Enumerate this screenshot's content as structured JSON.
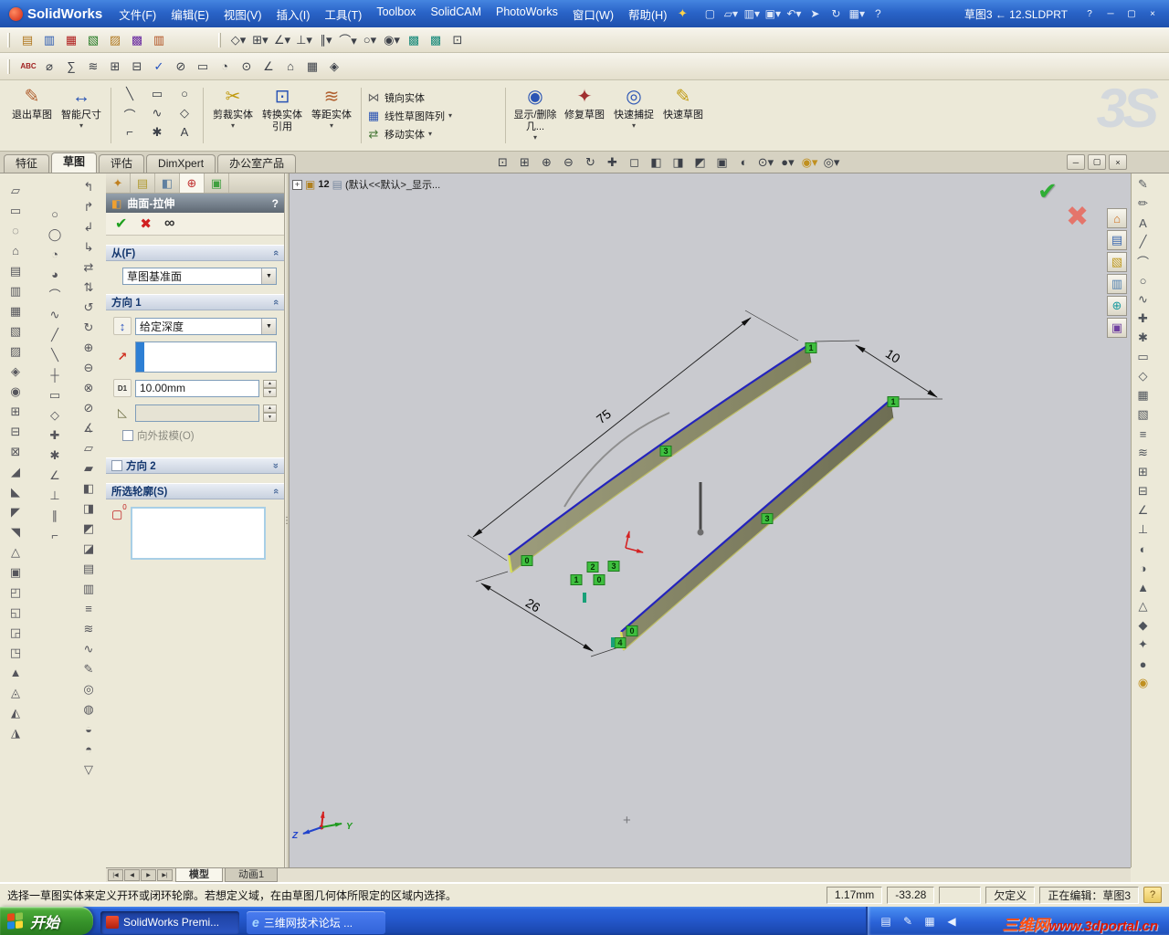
{
  "ui": {
    "chevron": "«",
    "combo_arrow": "▼",
    "spin_up": "▲",
    "spin_down": "▼",
    "drop": "▾",
    "expand": "+",
    "help": "?",
    "minimize": "─",
    "restore": "▢",
    "close": "×",
    "splitter": "⋮",
    "plus": "+"
  },
  "titlebar": {
    "app_name": "SolidWorks",
    "doc_title": "草图3 ← 12.SLDPRT",
    "assistant_icon": "✦",
    "menu_items": [
      "文件(F)",
      "编辑(E)",
      "视图(V)",
      "插入(I)",
      "工具(T)",
      "Toolbox",
      "SolidCAM",
      "PhotoWorks",
      "窗口(W)",
      "帮助(H)"
    ],
    "std_icons": [
      {
        "name": "new-doc-icon",
        "g": "▢"
      },
      {
        "name": "open-doc-icon",
        "g": "▱▾"
      },
      {
        "name": "save-icon",
        "g": "▥▾"
      },
      {
        "name": "print-icon",
        "g": "▣▾"
      },
      {
        "name": "undo-icon",
        "g": "↶▾"
      },
      {
        "name": "select-arrow-icon",
        "g": "➤"
      },
      {
        "name": "rebuild-icon",
        "g": "↻"
      },
      {
        "name": "options-icon",
        "g": "▦▾"
      },
      {
        "name": "help-icon",
        "g": "?"
      }
    ]
  },
  "toolbar_row1": {
    "left_icons": [
      {
        "name": "layer-icon",
        "g": "▤",
        "c": "#b07820"
      },
      {
        "name": "layer-props-icon",
        "g": "▥",
        "c": "#2858b0"
      },
      {
        "name": "color-swatch-icon",
        "g": "▦",
        "c": "#b02020"
      },
      {
        "name": "line-format-icon",
        "g": "▧",
        "c": "#207820"
      },
      {
        "name": "hatch-icon",
        "g": "▨",
        "c": "#b07820"
      },
      {
        "name": "grid-icon",
        "g": "▩",
        "c": "#6828a0"
      },
      {
        "name": "units-icon",
        "g": "▥",
        "c": "#b05020"
      }
    ],
    "snap_icons": [
      "◇▾",
      "⊞▾",
      "∠▾",
      "⊥▾",
      "∥▾",
      "⌒▾",
      "○▾",
      "◉▾",
      {
        "name": "solid-snap-icon",
        "g": "▩",
        "c": "#188a7a"
      },
      {
        "name": "solid-snap2-icon",
        "g": "▩",
        "c": "#188a7a"
      },
      "⊡"
    ]
  },
  "toolbar_row2": {
    "abc_label": "ABC",
    "icons": [
      "⌀",
      "∑",
      "≋",
      "⊞",
      "⊟",
      {
        "name": "check-sketch-icon",
        "g": "✓",
        "c": "#2050c0"
      },
      "⊘",
      "▭",
      "◔",
      "⊙",
      "∠",
      "⌂",
      "▦",
      "◈"
    ]
  },
  "cmd": {
    "exit_sketch": {
      "label": "退出草图",
      "g": "✎"
    },
    "smart_dim": {
      "label": "智能尺寸",
      "g": "↔"
    },
    "entity_icons": [
      "╲",
      "▭",
      "○",
      "⌒",
      "∿",
      "◇",
      "⌐",
      "✱",
      "A"
    ],
    "trim": {
      "label": "剪裁实体",
      "g": "✂"
    },
    "convert": {
      "label": "转换实体引用",
      "g": "⊡"
    },
    "offset": {
      "label": "等距实体",
      "g": "≋"
    },
    "mirror": {
      "label": "镜向实体",
      "g": "⋈"
    },
    "pattern": {
      "label": "线性草图阵列",
      "g": "▦"
    },
    "move": {
      "label": "移动实体",
      "g": "⇄"
    },
    "display_delete": {
      "label": "显示/删除几...",
      "g": "◉"
    },
    "repair": {
      "label": "修复草图",
      "g": "✦"
    },
    "quick_snap": {
      "label": "快速捕捉",
      "g": "◎"
    },
    "rapid_sketch": {
      "label": "快速草图",
      "g": "✎"
    },
    "ds_logo": "3S"
  },
  "command_tabs": [
    "特征",
    "草图",
    "评估",
    "DimXpert",
    "办公室产品"
  ],
  "headsup_icons": [
    "⊡",
    "⊞",
    "⊕",
    "⊖",
    "↻",
    "✚",
    "◻",
    "◧",
    "◨",
    "◩",
    "▣",
    "◐",
    "⊙▾",
    "●▾",
    {
      "name": "render-ball-icon",
      "g": "◉▾",
      "c": "#c09020"
    },
    "◎▾"
  ],
  "left_toolbars": {
    "col1": [
      "▱",
      "▭",
      "◌",
      "⌂",
      "▤",
      "▥",
      "▦",
      "▧",
      "▨",
      "◈",
      "◉",
      "⊞",
      "⊟",
      "⊠",
      "◢",
      "◣",
      "◤",
      "◥",
      "△",
      "▣",
      "◰",
      "◱",
      "◲",
      "◳",
      "▲",
      "◬",
      "◭",
      "◮"
    ],
    "col2": [
      "○",
      "◯",
      "◔",
      "◕",
      "⌒",
      "∿",
      "╱",
      "╲",
      "┼",
      "▭",
      "◇",
      "✚",
      "✱",
      "∠",
      "⊥",
      "∥",
      "⌐"
    ],
    "col3": [
      "↰",
      "↱",
      "↲",
      "↳",
      "⇄",
      "⇅",
      "↺",
      "↻",
      "⊕",
      "⊖",
      "⊗",
      "⊘",
      "∡",
      "▱",
      "▰",
      "◧",
      "◨",
      "◩",
      "◪",
      "▤",
      "▥",
      "≡",
      "≋",
      "∿",
      "✎",
      "◎",
      "◍",
      "◒",
      "◓",
      "▽"
    ]
  },
  "pm": {
    "title": "曲面-拉伸",
    "title_icon": "◧",
    "tab_icons": [
      {
        "g": "✦"
      },
      {
        "g": "▤"
      },
      {
        "g": "◧"
      },
      {
        "g": "⊕"
      },
      {
        "g": "▣"
      }
    ],
    "ok": "✔",
    "cancel": "✖",
    "preview": "∞",
    "from": {
      "header": "从(F)",
      "value": "草图基准面"
    },
    "dir1": {
      "header": "方向 1",
      "reverse_icon": "↕",
      "end_condition": "给定深度",
      "ref_icon": "↗",
      "depth_icon": "D1",
      "depth": "10.00mm",
      "draft_icon": "◺",
      "draft_label": "向外拔模(O)"
    },
    "dir2": {
      "header": "方向 2"
    },
    "contours": {
      "header": "所选轮廓(S)",
      "icon": "▢",
      "icon_sup": "0"
    }
  },
  "viewport": {
    "tree_label": "12",
    "tree_icon": "▣",
    "config_icon": "▤",
    "config_label": "(默认<<默认>_显示...",
    "confirm_glyph": "✔",
    "cancel_glyph": "✖",
    "dims": {
      "length": "75",
      "width_top": "10",
      "width_bottom": "26"
    },
    "badges": [
      {
        "n": "1"
      },
      {
        "n": "1"
      },
      {
        "n": "3"
      },
      {
        "n": "3"
      },
      {
        "n": "2"
      },
      {
        "n": "3"
      },
      {
        "n": "1"
      },
      {
        "n": "0"
      },
      {
        "n": "0"
      },
      {
        "n": "0"
      },
      {
        "n": "4"
      }
    ],
    "triad": {
      "y": "Y",
      "z": "Z"
    }
  },
  "taskpane_icons": [
    {
      "name": "home-icon",
      "g": "⌂",
      "c": "#d07020"
    },
    {
      "name": "design-library-icon",
      "g": "▤",
      "c": "#3a68b0"
    },
    {
      "name": "file-explorer-icon",
      "g": "▧",
      "c": "#c09a20"
    },
    {
      "name": "search-icon",
      "g": "▥",
      "c": "#5080b0"
    },
    {
      "name": "view-palette-icon",
      "g": "⊕",
      "c": "#1a9aa0"
    },
    {
      "name": "appearances-icon",
      "g": "▣",
      "c": "#7040a0"
    }
  ],
  "rightbar_icons": [
    "✎",
    "✏",
    "A",
    "╱",
    "⌒",
    "○",
    "∿",
    "✚",
    "✱",
    "▭",
    "◇",
    "▦",
    "▧",
    "≡",
    "≋",
    "⊞",
    "⊟",
    "∠",
    "⊥",
    "◐",
    "◑",
    "▲",
    "△",
    "◆",
    "✦",
    "●",
    {
      "name": "appearance-target-icon",
      "g": "◉",
      "c": "#c09020"
    }
  ],
  "model_tabs": {
    "nav": [
      "|◀",
      "◀",
      "▶",
      "▶|"
    ],
    "tabs": [
      "模型",
      "动画1"
    ]
  },
  "statusbar": {
    "message": "选择一草图实体来定义开环或闭环轮廓。若想定义域，在由草图几何体所限定的区域内选择。",
    "val1": "1.17mm",
    "val2": "-33.28",
    "state": "欠定义",
    "editing": "正在编辑：草图3",
    "tip_icon": "?"
  },
  "taskbar": {
    "start_label": "开始",
    "tasks": [
      {
        "label": "SolidWorks Premi...",
        "icon": "solidworks-icon"
      },
      {
        "label": "三维网技术论坛 ...",
        "icon": "ie-icon",
        "icon_glyph": "e"
      }
    ],
    "tray_icons": [
      {
        "name": "input-method-icon",
        "g": "▤"
      },
      {
        "name": "pen-icon",
        "g": "✎"
      },
      {
        "name": "keyboard-icon",
        "g": "▦"
      },
      {
        "name": "volume-icon",
        "g": "◀"
      }
    ],
    "watermark_brand": "三维网",
    "watermark_url": "www.3dportal.cn"
  }
}
